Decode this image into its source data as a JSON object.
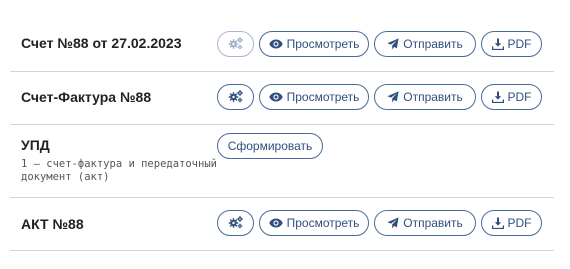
{
  "rows": [
    {
      "title": "Счет №88 от 27.02.2023",
      "gear_disabled": true,
      "view_label": "Просмотреть",
      "send_label": "Отправить",
      "pdf_label": "PDF"
    },
    {
      "title": "Счет-Фактура №88",
      "gear_disabled": false,
      "view_label": "Просмотреть",
      "send_label": "Отправить",
      "pdf_label": "PDF"
    },
    {
      "title": "УПД",
      "subtitle": "1 – счет-фактура и передаточный документ (акт)",
      "form_label": "Сформировать"
    },
    {
      "title": "АКТ №88",
      "gear_disabled": false,
      "view_label": "Просмотреть",
      "send_label": "Отправить",
      "pdf_label": "PDF"
    }
  ],
  "icons": {
    "settings": "gears-icon",
    "view": "eye-icon",
    "send": "paper-plane-icon",
    "pdf": "download-icon"
  },
  "colors": {
    "button_border": "#4a6a9c",
    "button_text": "#2f4f7f",
    "divider": "#d5d5d5"
  }
}
